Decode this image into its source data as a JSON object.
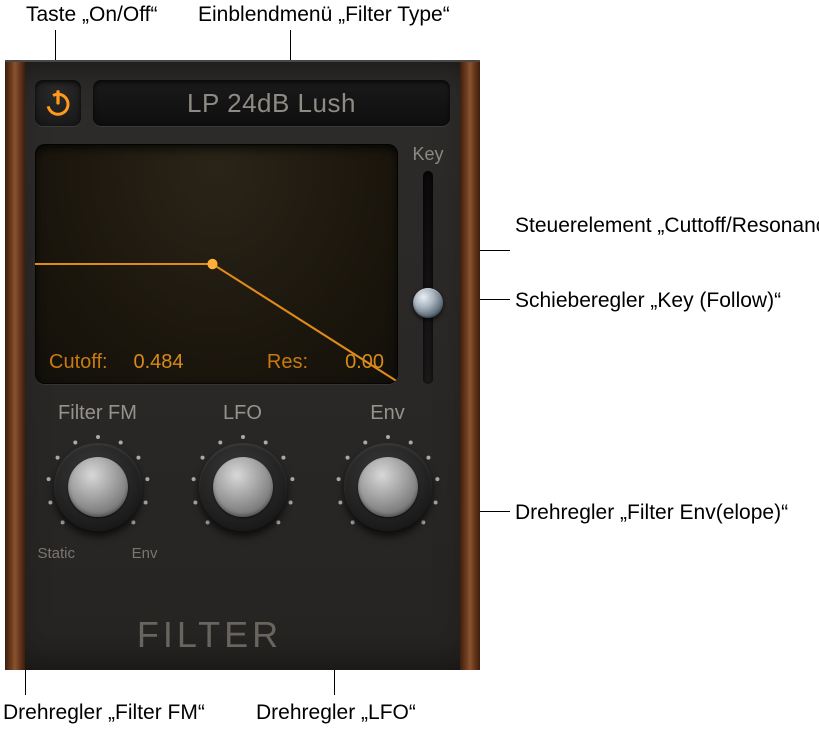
{
  "callouts": {
    "power": "Taste „On/Off“",
    "filter_menu": "Einblendmenü „Filter Type“",
    "cutoff_res": "Steuerelement „Cuttoff/Resonance“",
    "key_slider": "Schieberegler „Key (Follow)“",
    "env_knob": "Drehregler „Filter Env(elope)“",
    "fm_knob": "Drehregler „Filter FM“",
    "lfo_knob": "Drehregler „LFO“"
  },
  "filter_type": "LP 24dB Lush",
  "display": {
    "cutoff_label": "Cutoff:",
    "cutoff_value": "0.484",
    "res_label": "Res:",
    "res_value": "0.00"
  },
  "key_label": "Key",
  "knobs": {
    "fm": {
      "label": "Filter FM",
      "sub_left": "Static",
      "sub_right": "Env"
    },
    "lfo": {
      "label": "LFO"
    },
    "env": {
      "label": "Env"
    }
  },
  "section": "FILTER"
}
